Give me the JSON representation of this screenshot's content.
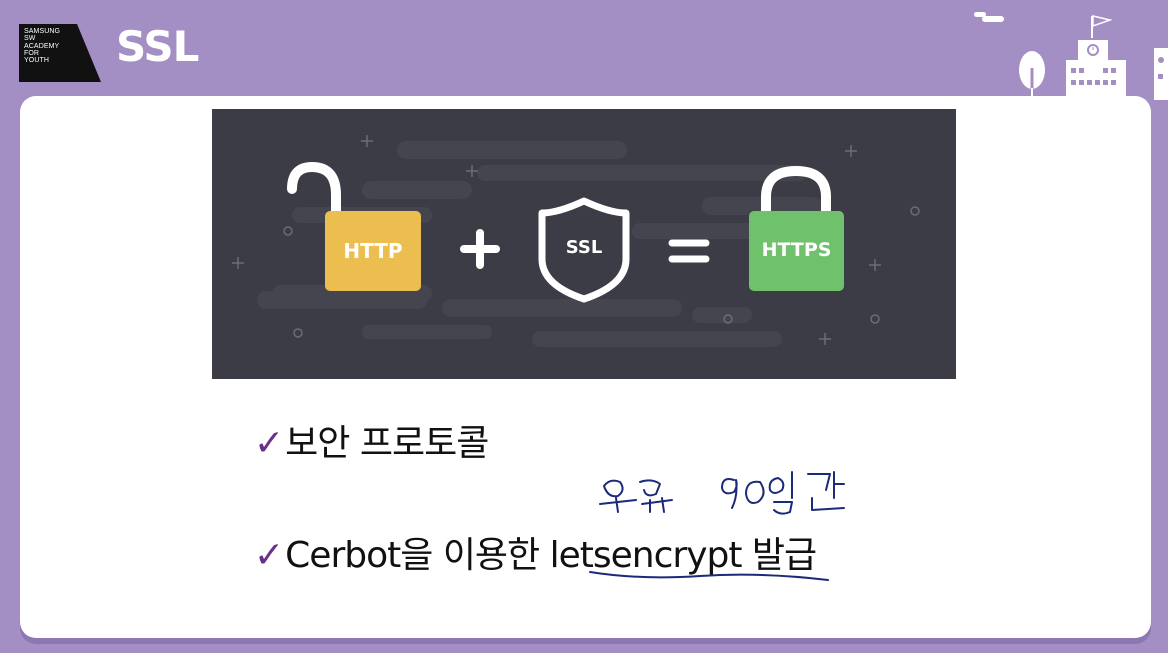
{
  "header": {
    "logo_lines": [
      "SAMSUNG",
      "SW",
      "ACADEMY",
      "FOR",
      "YOUTH"
    ],
    "title": "SSL"
  },
  "banner": {
    "http_label": "HTTP",
    "ssl_label": "SSL",
    "https_label": "HTTPS",
    "plus_symbol": "+",
    "equals_symbol": "=",
    "colors": {
      "background": "#3b3c45",
      "http_lock": "#ecbe4f",
      "https_lock": "#6fc16c",
      "shackle": "#ffffff"
    }
  },
  "bullets": [
    {
      "check": "✓",
      "text": "보안 프로토콜"
    },
    {
      "check": "✓",
      "text": "Cerbot을 이용한 letsencrypt 발급"
    }
  ],
  "colors": {
    "page_bg": "#a48fc5",
    "card_bg": "#ffffff",
    "check": "#6a2e8c",
    "ink": "#1b2a7a"
  }
}
